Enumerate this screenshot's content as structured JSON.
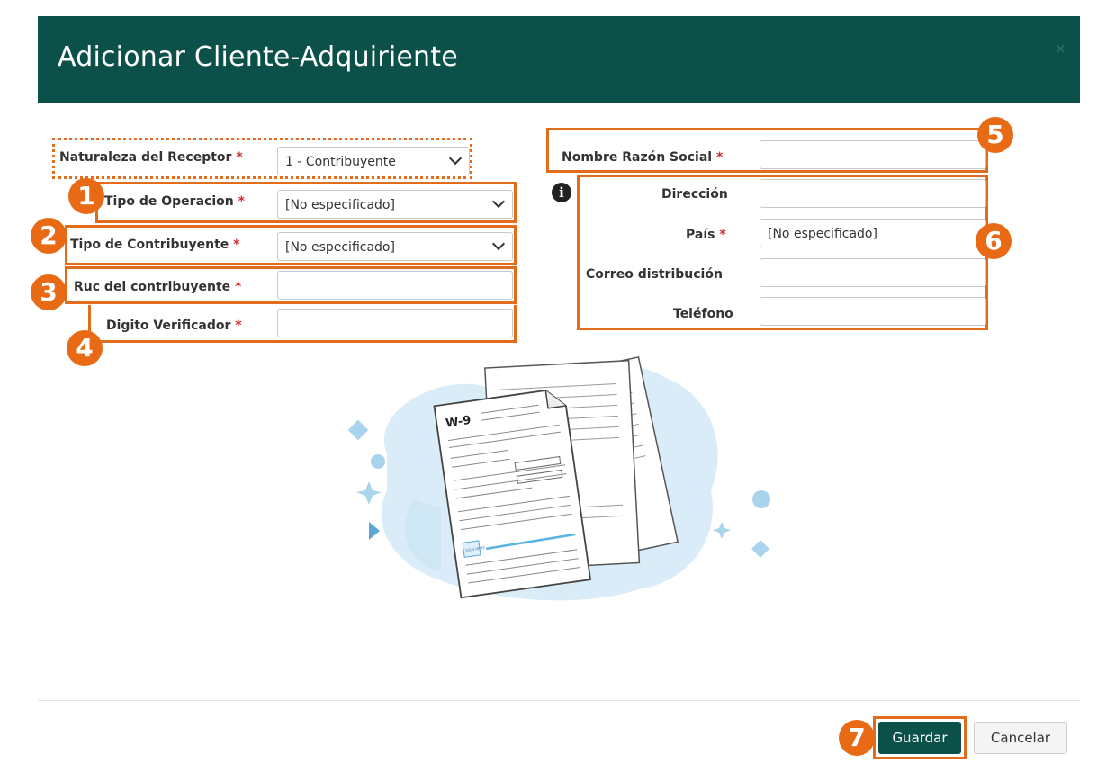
{
  "dialog": {
    "title": "Adicionar Cliente-Adquiriente",
    "close_label": "×"
  },
  "form_left": {
    "naturaleza_label": "Naturaleza del Receptor",
    "naturaleza_value": "1 - Contribuyente",
    "tipo_operacion_label": "Tipo de Operacion",
    "tipo_operacion_value": "[No especificado]",
    "tipo_contribuyente_label": "Tipo de Contribuyente",
    "tipo_contribuyente_value": "[No especificado]",
    "ruc_label": "Ruc del contribuyente",
    "ruc_value": "",
    "digito_label": "Digito Verificador",
    "digito_value": ""
  },
  "form_right": {
    "nombre_label": "Nombre Razón Social",
    "nombre_value": "",
    "direccion_label": "Dirección",
    "direccion_value": "",
    "pais_label": "País",
    "pais_value": "[No especificado]",
    "correo_label": "Correo distribución",
    "correo_value": "",
    "telefono_label": "Teléfono",
    "telefono_value": ""
  },
  "required_mark": "*",
  "badges": [
    "1",
    "2",
    "3",
    "4",
    "5",
    "6",
    "7"
  ],
  "illustration": {
    "form_code": "W-9",
    "sign_text": "SIGN HERE"
  },
  "footer": {
    "save_label": "Guardar",
    "cancel_label": "Cancelar"
  },
  "colors": {
    "header": "#0b5049",
    "highlight": "#e06c1c",
    "badge": "#e86a14",
    "required": "#cc2d2d"
  },
  "icons": [
    "info-icon",
    "chevron-down-icon",
    "close-icon"
  ]
}
